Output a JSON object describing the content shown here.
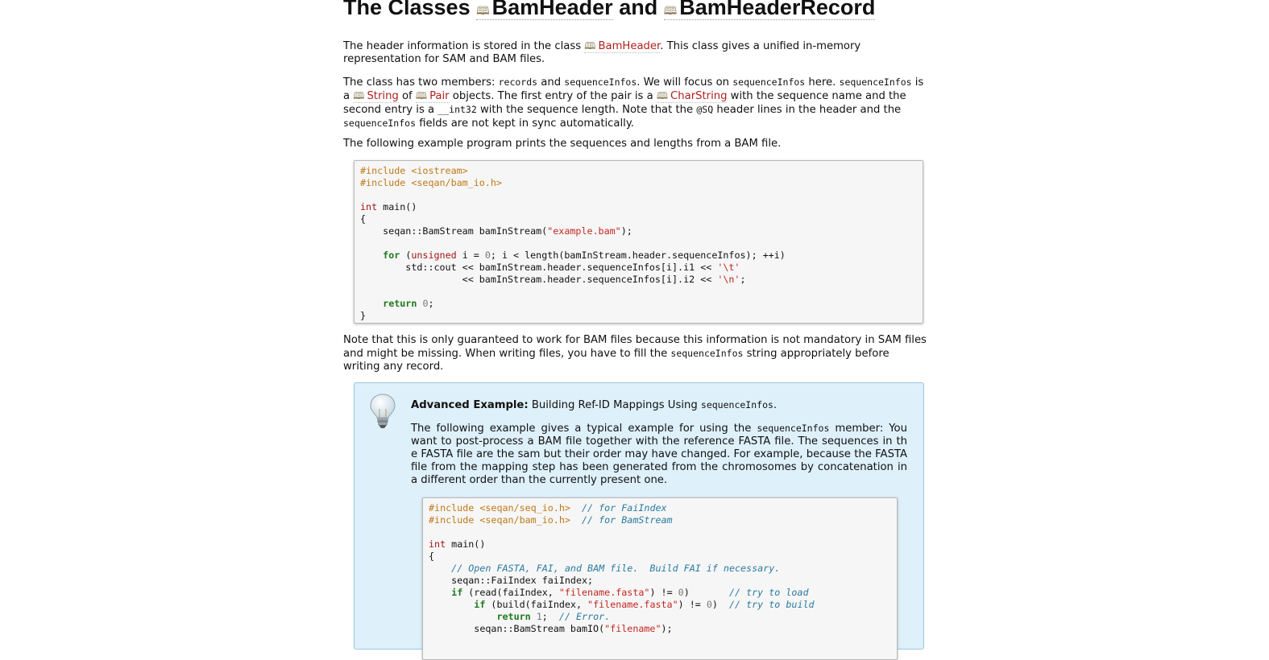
{
  "title": {
    "prefix": "The Classes",
    "class1": "BamHeader",
    "and": "and",
    "class2": "BamHeaderRecord"
  },
  "para1": {
    "t1": "The header information is stored in the class ",
    "link": "BamHeader",
    "t2": ". This class gives a unified in-memory representation for SAM and BAM files."
  },
  "para2": {
    "t1": "The class has two members: ",
    "c1": "records",
    "t2": " and ",
    "c2": "sequenceInfos",
    "t3": ". We will focus on ",
    "c3": "sequenceInfos",
    "t4": " here. ",
    "c4": "sequenceInfos",
    "t5": " is a ",
    "link1": "String",
    "t6": " of ",
    "link2": "Pair",
    "t7": " objects. The first entry of the pair is a ",
    "link3": "CharString",
    "t8": " with the sequence name and the second entry is a ",
    "c5": "__int32",
    "t9": " with the sequence length. Note that the ",
    "c6": "@SQ",
    "t10": " header lines in the header and the ",
    "c7": "sequenceInfos",
    "t11": " fields are not kept in sync automatically."
  },
  "para3": "The following example program prints the sequences and lengths from a BAM file.",
  "code1": {
    "l1": "#include <iostream>",
    "l2": "#include <seqan/bam_io.h>",
    "l3_kw": "int",
    "l3_rest": " main()",
    "l4": "{",
    "l5_a": "    seqan::BamStream bamInStream(",
    "l5_str": "\"example.bam\"",
    "l5_b": ");",
    "l6_ind": "    ",
    "l6_for": "for",
    "l6_a": " (",
    "l6_uns": "unsigned",
    "l6_b": " i = ",
    "l6_zero": "0",
    "l6_c": "; i < length(bamInStream.header.sequenceInfos); ++i)",
    "l7_a": "        std::cout << bamInStream.header.sequenceInfos[i].i1 << ",
    "l7_str": "'\\t'",
    "l8_a": "                  << bamInStream.header.sequenceInfos[i].i2 << ",
    "l8_str": "'\\n'",
    "l8_b": ";",
    "l9_ind": "    ",
    "l9_ret": "return",
    "l9_sp": " ",
    "l9_zero": "0",
    "l9_b": ";",
    "l10": "}"
  },
  "para4": {
    "t1": "Note that this is only guaranteed to work for BAM files because this information is not mandatory in SAM files and might be missing. When writing files, you have to fill the ",
    "c1": "sequenceInfos",
    "t2": " string appropriately before writing any record."
  },
  "tip": {
    "icon": "lightbulb-icon",
    "heading_bold": "Advanced Example:",
    "heading_rest": " Building Ref-ID Mappings Using ",
    "heading_code": "sequenceInfos",
    "heading_end": ".",
    "p_t1": "The following example gives a typical example for using the ",
    "p_c1": "sequenceInfos",
    "p_t2": " member: You want to post-process a BAM file together with the reference FASTA file. The sequences in th e FASTA file are the sam but their order may have changed. For example, because the FASTA file from the mapping step has been generated from the chromosomes by concatenation in a different order than the currently present one."
  },
  "code2": {
    "l1_pp": "#include <seqan/seq_io.h>",
    "l1_sp": "  ",
    "l1_cm": "// for FaiIndex",
    "l2_pp": "#include <seqan/bam_io.h>",
    "l2_sp": "  ",
    "l2_cm": "// for BamStream",
    "l3_kw": "int",
    "l3_rest": " main()",
    "l4": "{",
    "l5_ind": "    ",
    "l5_cm": "// Open FASTA, FAI, and BAM file.  Build FAI if necessary.",
    "l6": "    seqan::FaiIndex faiIndex;",
    "l7_ind": "    ",
    "l7_if": "if",
    "l7_a": " (read(faiIndex, ",
    "l7_str": "\"filename.fasta\"",
    "l7_b": ") != ",
    "l7_zero": "0",
    "l7_c": ")       ",
    "l7_cm": "// try to load",
    "l8_ind": "        ",
    "l8_if": "if",
    "l8_a": " (build(faiIndex, ",
    "l8_str": "\"filename.fasta\"",
    "l8_b": ") != ",
    "l8_zero": "0",
    "l8_c": ")  ",
    "l8_cm": "// try to build",
    "l9_ind": "            ",
    "l9_ret": "return",
    "l9_sp": " ",
    "l9_one": "1",
    "l9_b": ";  ",
    "l9_cm": "// Error.",
    "l10_a": "        seqan::BamStream bamIO(",
    "l10_str": "\"filename\"",
    "l10_b": ");"
  },
  "colors": {
    "link": "#b0201e",
    "preprocessor": "#c07818",
    "keyword": "#a31515",
    "string": "#c3271f",
    "comment": "#2a7aa0",
    "tip_background": "#def0fa"
  }
}
